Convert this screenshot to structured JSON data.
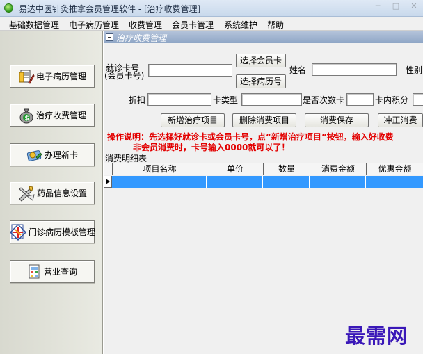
{
  "window": {
    "title": "易达中医针灸推拿会员管理软件 - [治疗收费管理]"
  },
  "menu": [
    "基础数据管理",
    "电子病历管理",
    "收费管理",
    "会员卡管理",
    "系统维护",
    "帮助"
  ],
  "nav": [
    {
      "label": "电子病历管理",
      "icon": "medical-record-icon"
    },
    {
      "label": "治疗收费管理",
      "icon": "money-bag-icon"
    },
    {
      "label": "办理新卡",
      "icon": "card-icon"
    },
    {
      "label": "药品信息设置",
      "icon": "tools-icon"
    },
    {
      "label": "门诊病历模板管理",
      "icon": "template-icon"
    },
    {
      "label": "营业查询",
      "icon": "query-icon"
    }
  ],
  "panel": {
    "title": "治疗收费管理"
  },
  "form": {
    "card_no_label_1": "就诊卡号",
    "card_no_label_2": "(会员卡号)",
    "select_member_card": "选择会员卡",
    "select_record_no": "选择病历号",
    "name_label": "姓名",
    "gender_label_partial": "性别",
    "discount_label": "折扣",
    "card_type_label": "卡类型",
    "is_times_card_label": "是否次数卡",
    "card_points_label": "卡内积分"
  },
  "buttons": {
    "add_item": "新增治疗项目",
    "delete_item": "删除消费项目",
    "save": "消费保存",
    "reverse": "冲正消费"
  },
  "instruction": {
    "line1": "操作说明：先选择好就诊卡或会员卡号，点“新增治疗项目”按钮，输入好收费",
    "line2": "非会员消费时，卡号输入0000就可以了！"
  },
  "table": {
    "caption": "消费明细表",
    "columns": [
      "项目名称",
      "单价",
      "数量",
      "消费金额",
      "优惠金额"
    ]
  },
  "watermark": "最需网"
}
